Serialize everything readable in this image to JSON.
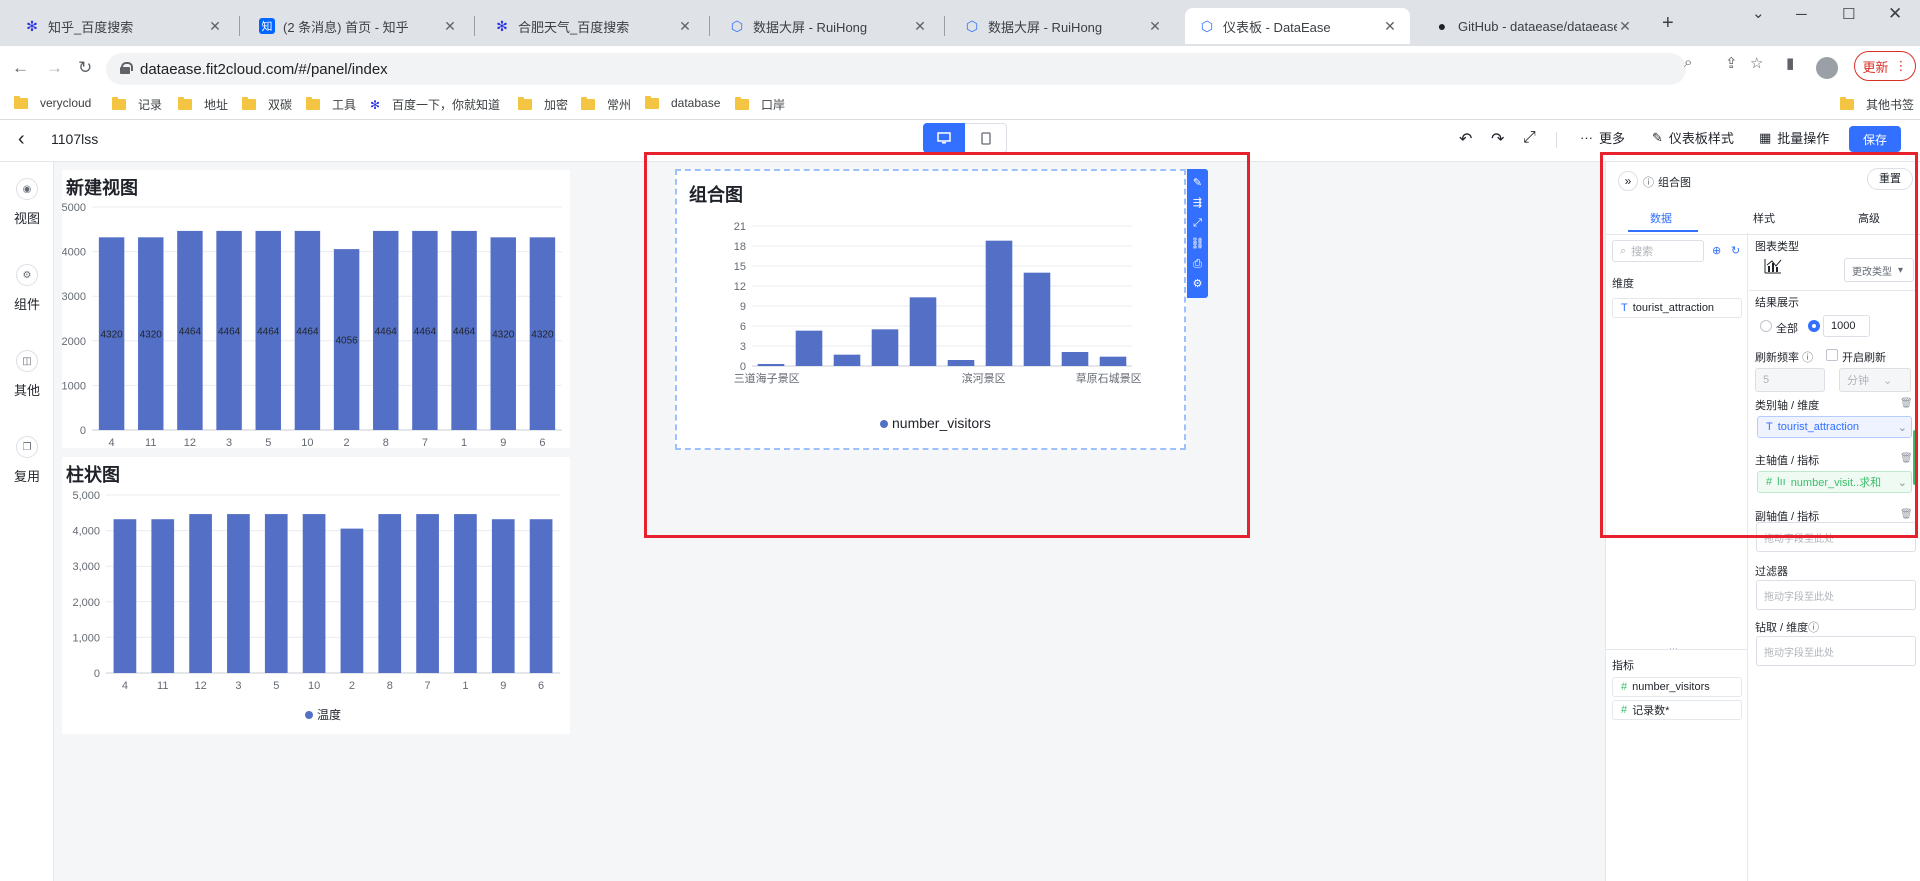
{
  "browser": {
    "tabs": [
      {
        "title": "知乎_百度搜索",
        "icon": "baidu-paw-icon",
        "color": "#2932e1"
      },
      {
        "title": "(2 条消息) 首页 - 知乎",
        "icon": "zhihu-icon",
        "color": "#0066ff"
      },
      {
        "title": "合肥天气_百度搜索",
        "icon": "baidu-paw-icon",
        "color": "#2932e1"
      },
      {
        "title": "数据大屏 - RuiHong",
        "icon": "hexagon-icon",
        "color": "#3370ff"
      },
      {
        "title": "数据大屏 - RuiHong",
        "icon": "hexagon-icon",
        "color": "#3370ff"
      },
      {
        "title": "仪表板 - DataEase",
        "icon": "hexagon-icon",
        "color": "#3370ff"
      },
      {
        "title": "GitHub - dataease/dataease:",
        "icon": "github-icon",
        "color": "#1f2329"
      }
    ],
    "url": "dataease.fit2cloud.com/#/panel/index",
    "update_label": "更新",
    "bookmarks": [
      {
        "label": "verycloud",
        "icon": "folder-icon"
      },
      {
        "label": "记录",
        "icon": "folder-icon"
      },
      {
        "label": "地址",
        "icon": "folder-icon"
      },
      {
        "label": "双碳",
        "icon": "folder-icon"
      },
      {
        "label": "工具",
        "icon": "folder-icon"
      },
      {
        "label": "百度一下，你就知道",
        "icon": "baidu-paw-icon"
      },
      {
        "label": "加密",
        "icon": "folder-icon"
      },
      {
        "label": "常州",
        "icon": "folder-icon"
      },
      {
        "label": "database",
        "icon": "folder-icon"
      },
      {
        "label": "口岸",
        "icon": "folder-icon"
      }
    ],
    "other_bookmarks": "其他书签"
  },
  "app": {
    "panel_title": "1107lss",
    "more_label": "更多",
    "style_label": "仪表板样式",
    "batch_label": "批量操作",
    "save_label": "保存",
    "accent": "#3370ff"
  },
  "rail": [
    {
      "label": "视图",
      "icon": "view-icon"
    },
    {
      "label": "组件",
      "icon": "component-icon"
    },
    {
      "label": "其他",
      "icon": "other-icon"
    },
    {
      "label": "复用",
      "icon": "reuse-icon"
    }
  ],
  "chart_data": [
    {
      "type": "bar",
      "title": "新建视图",
      "categories": [
        "4",
        "11",
        "12",
        "3",
        "5",
        "10",
        "2",
        "8",
        "7",
        "1",
        "9",
        "6"
      ],
      "values": [
        4320,
        4320,
        4464,
        4464,
        4464,
        4464,
        4056,
        4464,
        4464,
        4464,
        4320,
        4320
      ],
      "yticks": [
        "0",
        "1000",
        "2000",
        "3000",
        "4000",
        "5000"
      ],
      "ylim": [
        0,
        5000
      ],
      "data_labels": true,
      "color": "#5470c6"
    },
    {
      "type": "bar",
      "title": "柱状图",
      "categories": [
        "4",
        "11",
        "12",
        "3",
        "5",
        "10",
        "2",
        "8",
        "7",
        "1",
        "9",
        "6"
      ],
      "values": [
        4320,
        4320,
        4464,
        4464,
        4464,
        4464,
        4056,
        4464,
        4464,
        4464,
        4320,
        4320
      ],
      "yticks": [
        "0",
        "1,000",
        "2,000",
        "3,000",
        "4,000",
        "5,000"
      ],
      "ylim": [
        0,
        5000
      ],
      "legend": [
        "温度"
      ],
      "legend_position": "bottom-center",
      "color": "#5470c6"
    },
    {
      "type": "bar",
      "title": "组合图",
      "categories": [
        "三道海子景区",
        "",
        "",
        "",
        "",
        "",
        "滨河景区",
        "",
        "",
        "草原石城景区"
      ],
      "values": [
        0.3,
        5.3,
        1.7,
        5.5,
        10.3,
        0.9,
        18.8,
        14.0,
        2.1,
        1.4
      ],
      "yticks": [
        "0",
        "3",
        "6",
        "9",
        "12",
        "15",
        "18",
        "21"
      ],
      "ylim": [
        0,
        21
      ],
      "legend": [
        "number_visitors"
      ],
      "legend_position": "bottom-center",
      "color": "#5470c6"
    }
  ],
  "right_panel": {
    "header_title": "组合图",
    "reset_label": "重置",
    "tabs": [
      "数据",
      "样式",
      "高级"
    ],
    "search_placeholder": "搜索",
    "dimension_title": "维度",
    "dimension_fields": [
      "tourist_attraction"
    ],
    "measure_title": "指标",
    "measure_fields": [
      "number_visitors",
      "记录数*"
    ],
    "chart_type_label": "图表类型",
    "change_type_label": "更改类型",
    "result_label": "结果展示",
    "result_all": "全部",
    "result_limit": "1000",
    "refresh_label": "刷新频率",
    "enable_refresh": "开启刷新",
    "refresh_value": "5",
    "refresh_unit": "分钟",
    "category_axis_label": "类别轴 / 维度",
    "category_axis_field": "tourist_attraction",
    "main_axis_label": "主轴值 / 指标",
    "main_axis_field": "number_visit..求和",
    "sub_axis_label": "副轴值 / 指标",
    "sub_axis_placeholder": "拖动字段至此处",
    "filter_label": "过滤器",
    "filter_placeholder": "拖动字段至此处",
    "drill_label": "钻取 / 维度",
    "drill_placeholder": "拖动字段至此处"
  }
}
